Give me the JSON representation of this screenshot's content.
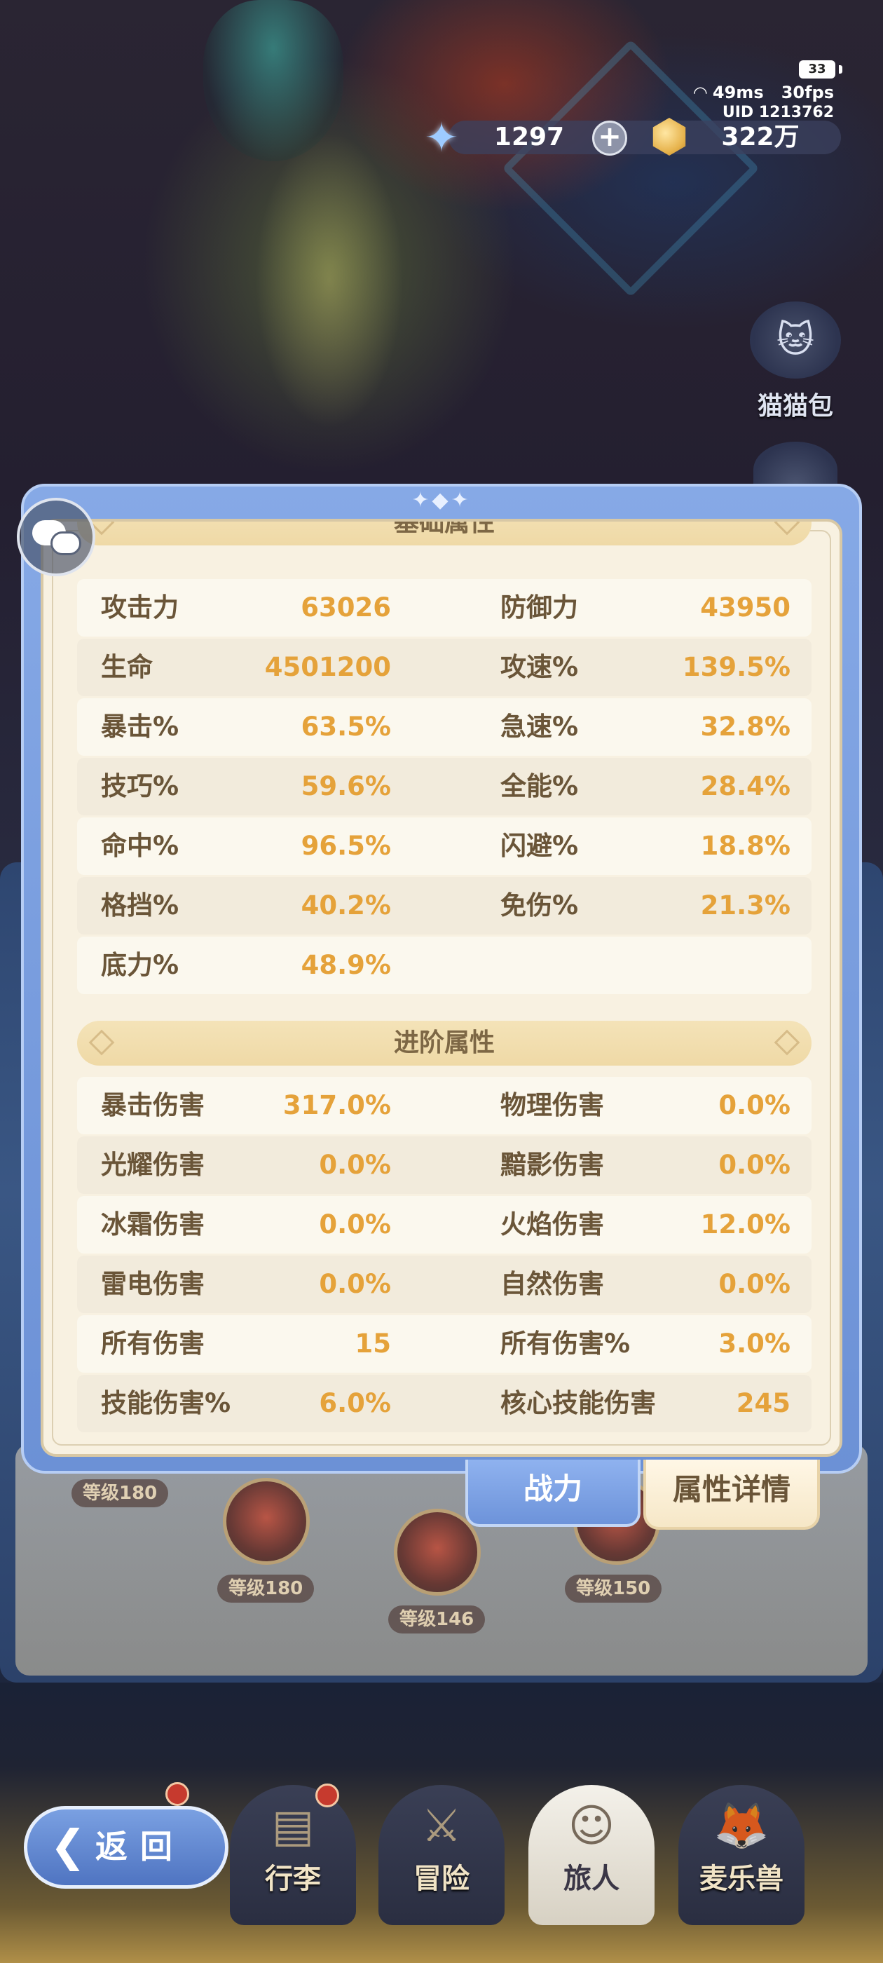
{
  "status": {
    "battery": "33",
    "ping": "49ms",
    "fps": "30fps",
    "uid": "UID 1213762"
  },
  "currency": {
    "gems": "1297",
    "coins": "322万"
  },
  "side": {
    "bag_label": "猫猫包"
  },
  "panel": {
    "basic_title": "基础属性",
    "basic_rows": [
      {
        "l1": "攻击力",
        "v1": "63026",
        "l2": "防御力",
        "v2": "43950"
      },
      {
        "l1": "生命",
        "v1": "4501200",
        "l2": "攻速%",
        "v2": "139.5%"
      },
      {
        "l1": "暴击%",
        "v1": "63.5%",
        "l2": "急速%",
        "v2": "32.8%"
      },
      {
        "l1": "技巧%",
        "v1": "59.6%",
        "l2": "全能%",
        "v2": "28.4%"
      },
      {
        "l1": "命中%",
        "v1": "96.5%",
        "l2": "闪避%",
        "v2": "18.8%"
      },
      {
        "l1": "格挡%",
        "v1": "40.2%",
        "l2": "免伤%",
        "v2": "21.3%"
      },
      {
        "l1": "底力%",
        "v1": "48.9%",
        "l2": "",
        "v2": ""
      }
    ],
    "advanced_title": "进阶属性",
    "advanced_rows": [
      {
        "l1": "暴击伤害",
        "v1": "317.0%",
        "l2": "物理伤害",
        "v2": "0.0%"
      },
      {
        "l1": "光耀伤害",
        "v1": "0.0%",
        "l2": "黯影伤害",
        "v2": "0.0%"
      },
      {
        "l1": "冰霜伤害",
        "v1": "0.0%",
        "l2": "火焰伤害",
        "v2": "12.0%"
      },
      {
        "l1": "雷电伤害",
        "v1": "0.0%",
        "l2": "自然伤害",
        "v2": "0.0%"
      },
      {
        "l1": "所有伤害",
        "v1": "15",
        "l2": "所有伤害%",
        "v2": "3.0%"
      },
      {
        "l1": "技能伤害%",
        "v1": "6.0%",
        "l2": "核心技能伤害",
        "v2": "245"
      }
    ]
  },
  "tabs": {
    "combat": "战力",
    "details": "属性详情"
  },
  "background": {
    "levels": [
      "等级180",
      "等级180",
      "等级146",
      "等级150"
    ]
  },
  "nav": {
    "back": "返回",
    "items": [
      "行李",
      "冒险",
      "旅人",
      "麦乐兽"
    ]
  }
}
